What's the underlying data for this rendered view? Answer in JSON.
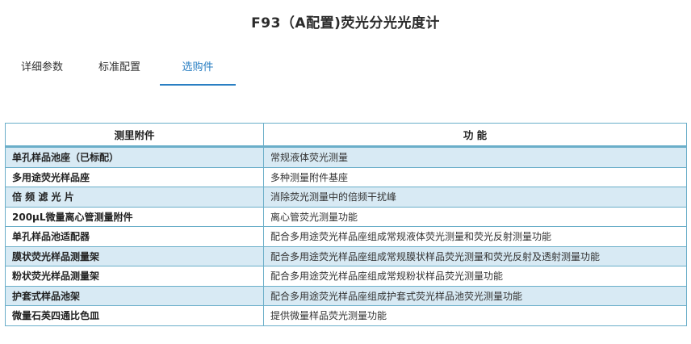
{
  "page": {
    "title": "F93（A配置)荧光分光光度计"
  },
  "tabs": [
    {
      "label": "详细参数",
      "active": false
    },
    {
      "label": "标准配置",
      "active": false
    },
    {
      "label": "选购件",
      "active": true
    }
  ],
  "colors": {
    "accent": "#2a7fc3",
    "table_border": "#6aaec9",
    "row_shade": "#d8eaf4"
  },
  "table": {
    "headers": [
      "测里附件",
      "功  能"
    ],
    "rows": [
      {
        "name": "单孔样品池座（已标配）",
        "function": "常规液体荧光测量"
      },
      {
        "name": "多用途荧光样品座",
        "function": "多种测量附件基座"
      },
      {
        "name": "倍 频 滤 光 片",
        "function": "消除荧光测量中的倍频干扰峰"
      },
      {
        "name": "200μL微量离心管测量附件",
        "function": "离心管荧光测量功能"
      },
      {
        "name": "单孔样品池适配器",
        "function": "配合多用途荧光样品座组成常规液体荧光测量和荧光反射测量功能"
      },
      {
        "name": "膜状荧光样品测量架",
        "function": "配合多用途荧光样品座组成常规膜状样品荧光测量和荧光反射及透射测量功能"
      },
      {
        "name": "粉状荧光样品测量架",
        "function": "配合多用途荧光样品座组成常规粉状样品荧光测量功能"
      },
      {
        "name": "护套式样品池架",
        "function": "配合多用途荧光样品座组成护套式荧光样品池荧光测量功能"
      },
      {
        "name": "微量石英四通比色皿",
        "function": "提供微量样品荧光测量功能"
      }
    ]
  }
}
